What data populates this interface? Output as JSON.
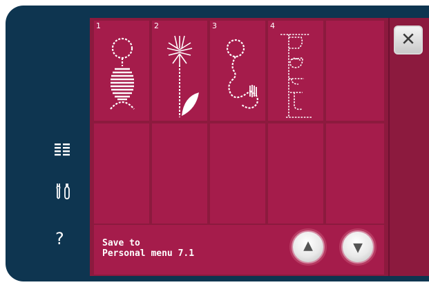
{
  "sidebar": {
    "icons": [
      {
        "name": "menu-list-icon"
      },
      {
        "name": "tools-icon"
      },
      {
        "name": "help-icon",
        "glyph": "?"
      }
    ]
  },
  "stitch_grid": {
    "cells": [
      {
        "number": "1",
        "stitch": "circle-stack-stitch"
      },
      {
        "number": "2",
        "stitch": "flower-stitch"
      },
      {
        "number": "3",
        "stitch": "swirl-stitch"
      },
      {
        "number": "4",
        "stitch": "letters-stitch"
      },
      {
        "number": "",
        "stitch": ""
      },
      {
        "number": "",
        "stitch": ""
      },
      {
        "number": "",
        "stitch": ""
      },
      {
        "number": "",
        "stitch": ""
      },
      {
        "number": "",
        "stitch": ""
      },
      {
        "number": "",
        "stitch": ""
      }
    ]
  },
  "footer": {
    "save_line1": "Save to",
    "save_line2": "Personal menu 7.1",
    "up_glyph": "▲",
    "down_glyph": "▼"
  },
  "close": {
    "glyph": "✕"
  },
  "colors": {
    "frame": "#0e3550",
    "panel": "#8c1a3e",
    "cell": "#a51c4b",
    "accent": "#b73a62"
  }
}
